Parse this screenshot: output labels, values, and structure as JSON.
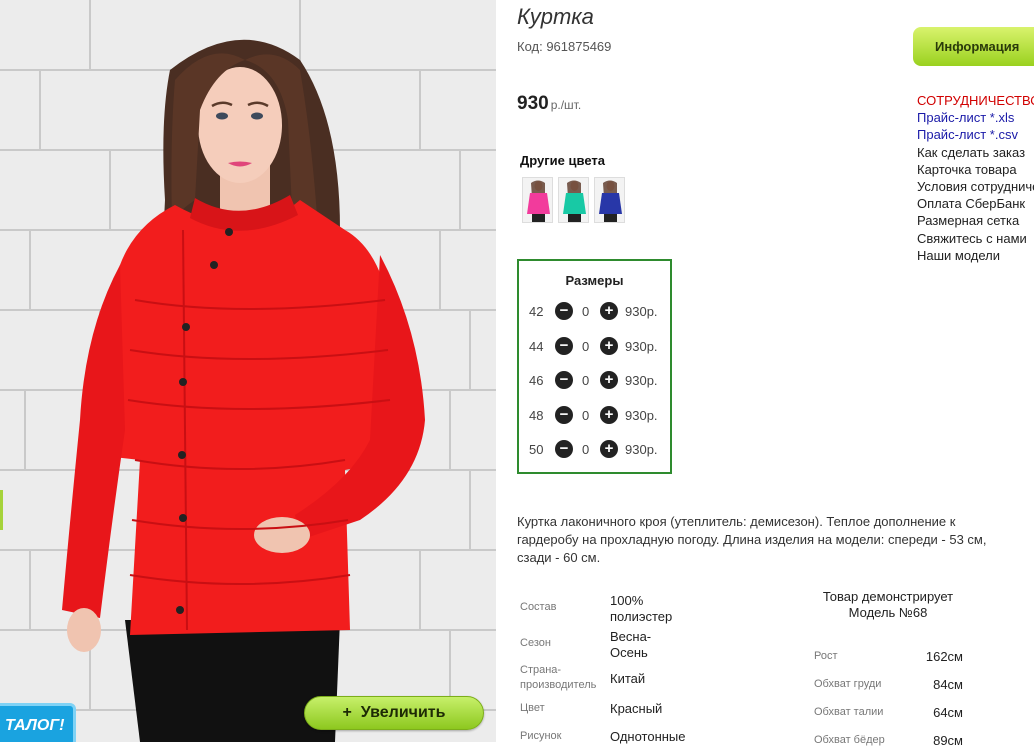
{
  "product": {
    "title": "Куртка",
    "code": "Код: 961875469",
    "price": "930",
    "price_unit": "р./шт.",
    "other_colors_title": "Другие цвета",
    "other_colors": [
      {
        "color": "#f23b9c"
      },
      {
        "color": "#18c9a5"
      },
      {
        "color": "#2837a8"
      }
    ]
  },
  "photo": {
    "jacket_color": "#f21d1d",
    "zoom_label": "Увеличить",
    "zoom_plus": "+",
    "catalog_label": "ТАЛОГ!"
  },
  "sizes": {
    "title": "Размеры",
    "rows": [
      {
        "size": "42",
        "qty": "0",
        "price": "930р."
      },
      {
        "size": "44",
        "qty": "0",
        "price": "930р."
      },
      {
        "size": "46",
        "qty": "0",
        "price": "930р."
      },
      {
        "size": "48",
        "qty": "0",
        "price": "930р."
      },
      {
        "size": "50",
        "qty": "0",
        "price": "930р."
      }
    ]
  },
  "sidebar": {
    "info_tab": "Информация",
    "links": [
      "СОТРУДНИЧЕСТВО",
      "Прайс-лист *.xls",
      "Прайс-лист *.csv",
      "Как сделать заказ",
      "Карточка товара",
      "Условия сотрудничества",
      "Оплата СберБанк",
      "Размерная сетка",
      "Свяжитесь с нами",
      "Наши модели"
    ]
  },
  "description": "Куртка лаконичного кроя (утеплитель: демисезон). Теплое дополнение к гардеробу на прохладную погоду. Длина изделия на модели: спереди - 53 см, сзади - 60 см.",
  "attributes": {
    "composition_label": "Состав",
    "composition_value_1": "100%",
    "composition_value_2": "полиэстер",
    "season_label": "Сезон",
    "season_value_1": "Весна-",
    "season_value_2": "Осень",
    "country_label_1": "Страна-",
    "country_label_2": "производитель",
    "country_value": "Китай",
    "color_label": "Цвет",
    "color_value": "Красный",
    "pattern_label": "Рисунок",
    "pattern_value": "Однотонные"
  },
  "model": {
    "title_1": "Товар демонстрирует",
    "title_2": "Модель №68",
    "measurements": [
      {
        "label": "Рост",
        "value": "162см"
      },
      {
        "label": "Обхват груди",
        "value": "84см"
      },
      {
        "label": "Обхват талии",
        "value": "64см"
      },
      {
        "label": "Обхват бёдер",
        "value": "89см"
      }
    ]
  }
}
